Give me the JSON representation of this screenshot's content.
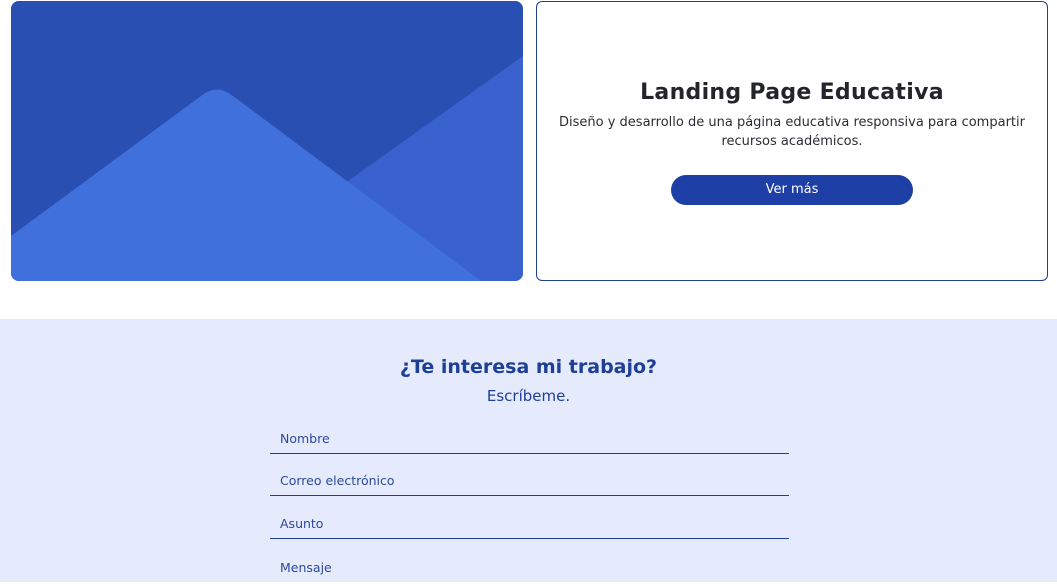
{
  "project": {
    "image_icon": "mountain-placeholder-icon",
    "title": "Landing Page Educativa",
    "description": "Diseño y desarrollo de una página educativa responsiva para compartir recursos académicos.",
    "button_label": "Ver más"
  },
  "contact": {
    "heading": "¿Te interesa mi trabajo?",
    "subheading": "Escríbeme.",
    "fields": {
      "name_placeholder": "Nombre",
      "email_placeholder": "Correo electrónico",
      "subject_placeholder": "Asunto",
      "message_placeholder": "Mensaje"
    }
  },
  "colors": {
    "accent": "#1e40a6",
    "contact_background": "#e5eafd",
    "card_border": "#1f3f8f"
  }
}
